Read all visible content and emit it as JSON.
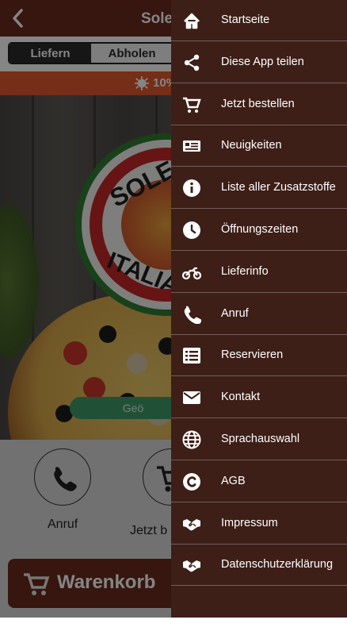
{
  "header": {
    "title": "Sole&",
    "back_icon": "chevron-left-icon"
  },
  "order_mode": {
    "options": [
      "Liefern",
      "Abholen"
    ],
    "selected": "Liefern"
  },
  "promo": {
    "text": "10%",
    "icon": "gear-icon",
    "color": "#e0582c"
  },
  "hero": {
    "logo_top_text": "SOLE&",
    "logo_bottom_text": "ITALIA",
    "geo_button_label": "Geö"
  },
  "quick_actions": [
    {
      "label": "Anruf",
      "icon": "phone-icon"
    },
    {
      "label": "Jetzt b",
      "icon": "cart-icon"
    }
  ],
  "cart_button": {
    "label": "Warenkorb",
    "icon": "cart-icon"
  },
  "menu": {
    "items": [
      {
        "label": "Startseite",
        "icon": "home-icon"
      },
      {
        "label": "Diese App teilen",
        "icon": "share-icon"
      },
      {
        "label": "Jetzt bestellen",
        "icon": "cart-icon"
      },
      {
        "label": "Neuigkeiten",
        "icon": "newspaper-icon"
      },
      {
        "label": "Liste aller Zusatzstoffe",
        "icon": "info-icon"
      },
      {
        "label": "Öffnungszeiten",
        "icon": "clock-icon"
      },
      {
        "label": "Lieferinfo",
        "icon": "motorcycle-icon"
      },
      {
        "label": "Anruf",
        "icon": "phone-icon"
      },
      {
        "label": "Reservieren",
        "icon": "list-icon"
      },
      {
        "label": "Kontakt",
        "icon": "envelope-icon"
      },
      {
        "label": "Sprachauswahl",
        "icon": "globe-icon"
      },
      {
        "label": "AGB",
        "icon": "copyright-icon"
      },
      {
        "label": "Impressum",
        "icon": "handshake-icon"
      },
      {
        "label": "Datenschutzerklärung",
        "icon": "handshake-icon"
      }
    ]
  },
  "colors": {
    "brand": "#6a2b1e",
    "drawer": "#3d1f18",
    "promo": "#e0582c",
    "geo": "#3f9b6a"
  }
}
